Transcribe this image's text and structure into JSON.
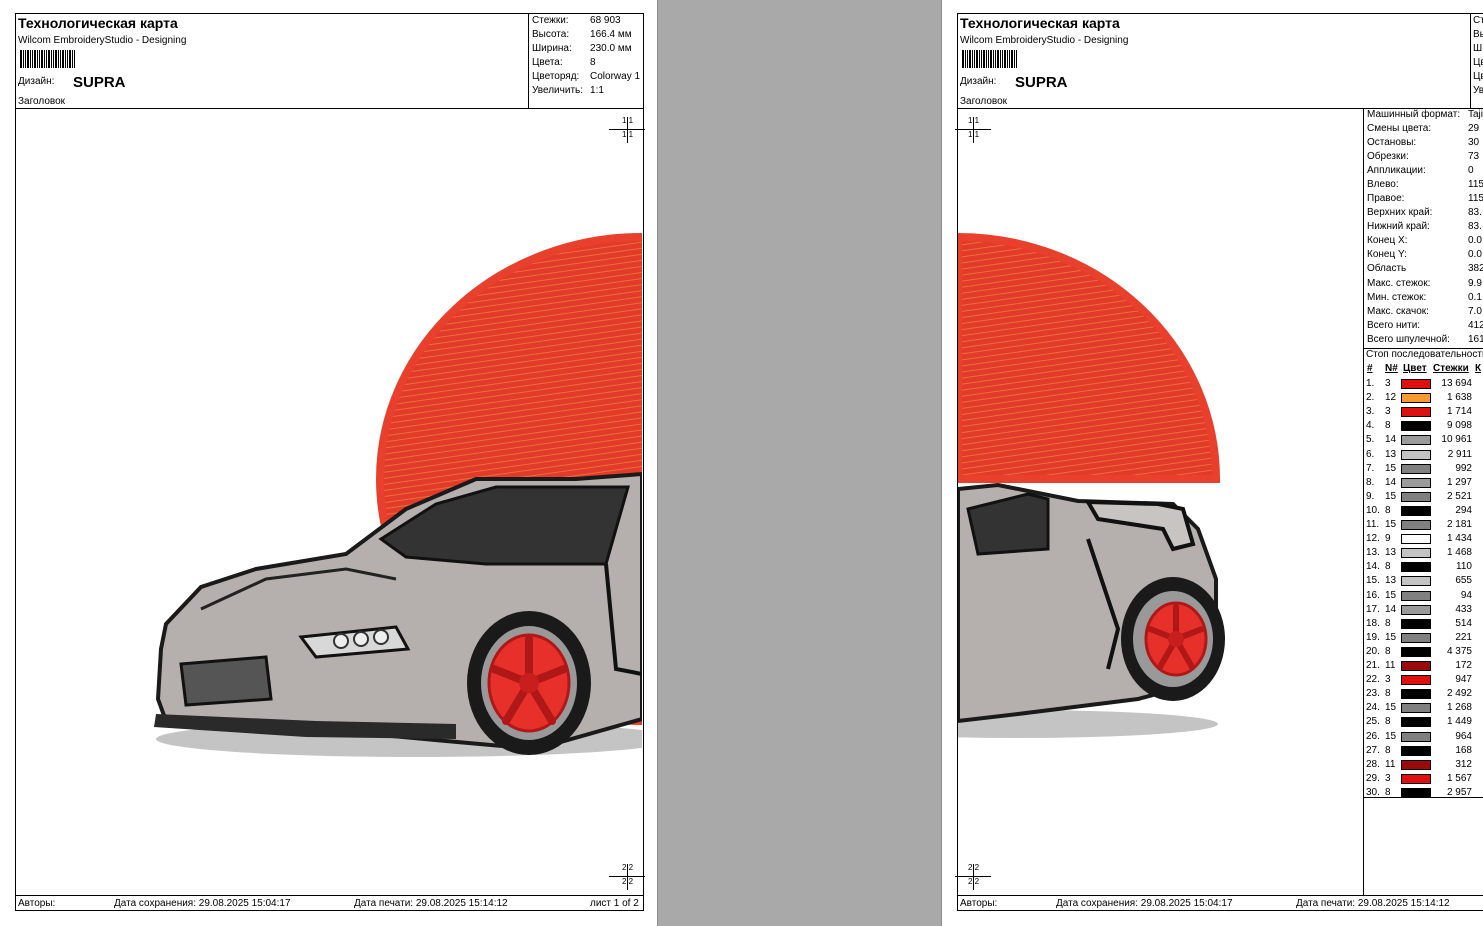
{
  "header": {
    "title": "Технологическая карта",
    "software": "Wilcom EmbroideryStudio - Designing",
    "design_label": "Дизайн:",
    "design_name": "SUPRA",
    "heading_label": "Заголовок"
  },
  "stats": [
    {
      "label": "Стежки:",
      "value": "68 903"
    },
    {
      "label": "Высота:",
      "value": "166.4 мм"
    },
    {
      "label": "Ширина:",
      "value": "230.0 мм"
    },
    {
      "label": "Цвета:",
      "value": "8"
    },
    {
      "label": "Цветоряд:",
      "value": "Colorway 1"
    },
    {
      "label": "Увеличить:",
      "value": "1:1"
    }
  ],
  "stats_page2": [
    "Ст",
    "Вы",
    "Ш",
    "Цв",
    "Цв",
    "Ув"
  ],
  "registration": {
    "top": "1 1",
    "bottom": "2 2"
  },
  "footer": {
    "authors": "Авторы:",
    "saved": "Дата сохранения: 29.08.2025 15:04:17",
    "printed": "Дата печати: 29.08.2025 15:14:12",
    "sheet": "лист 1 of 2"
  },
  "machine_info": [
    {
      "label": "Машинный формат:",
      "value": "Taji"
    },
    {
      "label": "Смены цвета:",
      "value": "29"
    },
    {
      "label": "Остановы:",
      "value": "30"
    },
    {
      "label": "Обрезки:",
      "value": "73"
    },
    {
      "label": "Аппликации:",
      "value": "0"
    },
    {
      "label": "Влево:",
      "value": "115"
    },
    {
      "label": "Правое:",
      "value": "115"
    },
    {
      "label": "Верхних край:",
      "value": "83."
    },
    {
      "label": "Нижний край:",
      "value": "83."
    },
    {
      "label": "Конец X:",
      "value": "0.0"
    },
    {
      "label": "Конец Y:",
      "value": "0.0"
    },
    {
      "label": "Область",
      "value": "382"
    },
    {
      "label": "Макс. стежок:",
      "value": "9.9"
    },
    {
      "label": "Мин. стежок:",
      "value": "0.1"
    },
    {
      "label": "Макс. скачок:",
      "value": "7.0"
    },
    {
      "label": "Всего нити:",
      "value": "412"
    },
    {
      "label": "Всего шпулечной:",
      "value": "161"
    }
  ],
  "stop_sequence": {
    "title": "Стоп последовательность",
    "headers": [
      "#",
      "N#",
      "Цвет",
      "Стежки",
      "К"
    ],
    "rows": [
      {
        "n": "1.",
        "c": "3",
        "color": "#e01010",
        "stitches": "13 694"
      },
      {
        "n": "2.",
        "c": "12",
        "color": "#f79a30",
        "stitches": "1 638"
      },
      {
        "n": "3.",
        "c": "3",
        "color": "#e01010",
        "stitches": "1 714"
      },
      {
        "n": "4.",
        "c": "8",
        "color": "#000000",
        "stitches": "9 098"
      },
      {
        "n": "5.",
        "c": "14",
        "color": "#9a9a9a",
        "stitches": "10 961"
      },
      {
        "n": "6.",
        "c": "13",
        "color": "#c4c4c4",
        "stitches": "2 911"
      },
      {
        "n": "7.",
        "c": "15",
        "color": "#808080",
        "stitches": "992"
      },
      {
        "n": "8.",
        "c": "14",
        "color": "#9a9a9a",
        "stitches": "1 297"
      },
      {
        "n": "9.",
        "c": "15",
        "color": "#808080",
        "stitches": "2 521"
      },
      {
        "n": "10.",
        "c": "8",
        "color": "#000000",
        "stitches": "294"
      },
      {
        "n": "11.",
        "c": "15",
        "color": "#808080",
        "stitches": "2 181"
      },
      {
        "n": "12.",
        "c": "9",
        "color": "#ffffff",
        "stitches": "1 434"
      },
      {
        "n": "13.",
        "c": "13",
        "color": "#c4c4c4",
        "stitches": "1 468"
      },
      {
        "n": "14.",
        "c": "8",
        "color": "#000000",
        "stitches": "110"
      },
      {
        "n": "15.",
        "c": "13",
        "color": "#c4c4c4",
        "stitches": "655"
      },
      {
        "n": "16.",
        "c": "15",
        "color": "#808080",
        "stitches": "94"
      },
      {
        "n": "17.",
        "c": "14",
        "color": "#9a9a9a",
        "stitches": "433"
      },
      {
        "n": "18.",
        "c": "8",
        "color": "#000000",
        "stitches": "514"
      },
      {
        "n": "19.",
        "c": "15",
        "color": "#808080",
        "stitches": "221"
      },
      {
        "n": "20.",
        "c": "8",
        "color": "#000000",
        "stitches": "4 375"
      },
      {
        "n": "21.",
        "c": "11",
        "color": "#9a0a0a",
        "stitches": "172"
      },
      {
        "n": "22.",
        "c": "3",
        "color": "#e01010",
        "stitches": "947"
      },
      {
        "n": "23.",
        "c": "8",
        "color": "#000000",
        "stitches": "2 492"
      },
      {
        "n": "24.",
        "c": "15",
        "color": "#808080",
        "stitches": "1 268"
      },
      {
        "n": "25.",
        "c": "8",
        "color": "#000000",
        "stitches": "1 449"
      },
      {
        "n": "26.",
        "c": "15",
        "color": "#808080",
        "stitches": "964"
      },
      {
        "n": "27.",
        "c": "8",
        "color": "#000000",
        "stitches": "168"
      },
      {
        "n": "28.",
        "c": "11",
        "color": "#9a0a0a",
        "stitches": "312"
      },
      {
        "n": "29.",
        "c": "3",
        "color": "#e01010",
        "stitches": "1 567"
      },
      {
        "n": "30.",
        "c": "8",
        "color": "#000000",
        "stitches": "2 957"
      }
    ]
  },
  "colors": {
    "sun_red": "#e43a2c",
    "car_grey": "#b5b0ae",
    "wheel_red": "#e8302a",
    "gap_grey": "#a9a9a9"
  }
}
